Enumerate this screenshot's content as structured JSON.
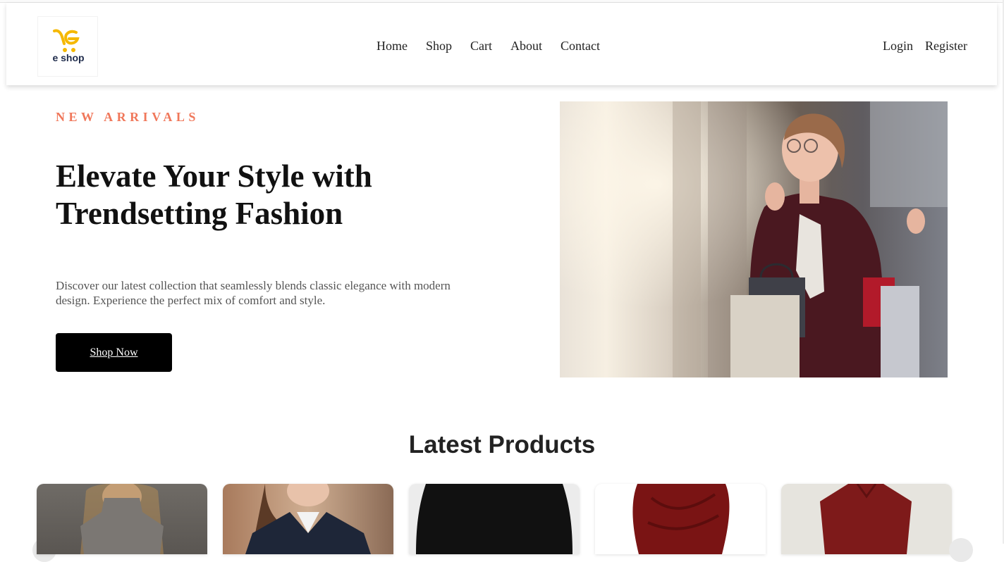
{
  "brand": {
    "logo_text": "e shop",
    "logo_color": "#f5b800"
  },
  "nav": {
    "home": "Home",
    "shop": "Shop",
    "cart": "Cart",
    "about": "About",
    "contact": "Contact"
  },
  "auth": {
    "login": "Login",
    "register": "Register"
  },
  "hero": {
    "eyebrow": "NEW ARRIVALS",
    "title_line1": "Elevate Your Style with",
    "title_line2": "Trendsetting Fashion",
    "description": "Discover our latest collection that seamlessly blends classic elegance with modern design. Experience the perfect mix of comfort and style.",
    "cta": "Shop Now",
    "accent_color": "#f0775a"
  },
  "latest": {
    "title": "Latest Products",
    "products": [
      {
        "image": "grey-knit-top"
      },
      {
        "image": "navy-blazer"
      },
      {
        "image": "black-skirt"
      },
      {
        "image": "red-twist-dress"
      },
      {
        "image": "red-long-sleeve-top"
      }
    ]
  }
}
